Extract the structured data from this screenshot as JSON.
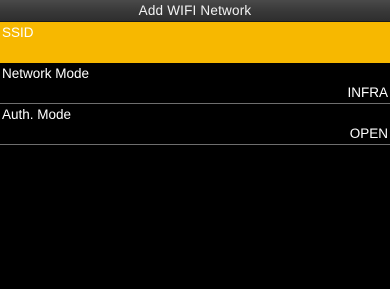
{
  "window": {
    "title": "Add WIFI Network"
  },
  "menu": {
    "items": [
      {
        "label": "SSID",
        "value": "",
        "selected": true
      },
      {
        "label": "Network Mode",
        "value": "INFRA",
        "selected": false
      },
      {
        "label": "Auth. Mode",
        "value": "OPEN",
        "selected": false
      }
    ]
  },
  "colors": {
    "highlight": "#f7b800",
    "background": "#000000",
    "title_bar": "#3a3a3a",
    "divider": "#6e6e6e",
    "text": "#ffffff"
  }
}
